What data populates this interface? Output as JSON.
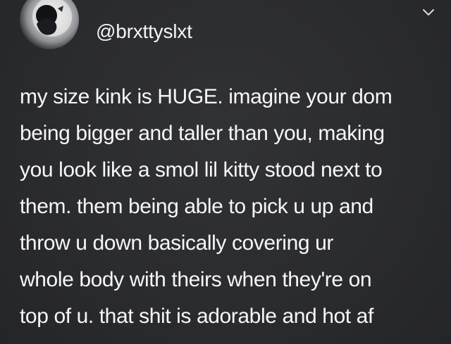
{
  "header": {
    "username": "@brxttyslxt"
  },
  "tweet": {
    "lines": [
      "my size kink is HUGE. imagine your dom",
      "being bigger and taller than you, making",
      "you look like a smol lil kitty stood next to",
      "them. them being able to pick u up and",
      "throw u down basically covering ur",
      "whole body with theirs when they're on",
      "top of u. that shit is adorable and hot af"
    ]
  },
  "icons": {
    "avatar": "profile-avatar",
    "menu": "chevron-down-icon"
  }
}
